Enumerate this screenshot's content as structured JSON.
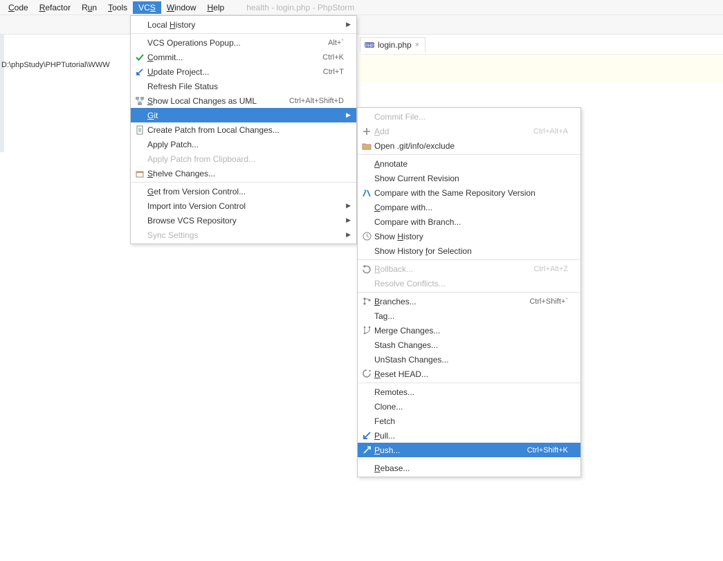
{
  "window_title": "health - login.php - PhpStorm",
  "menubar": [
    "Code",
    "Refactor",
    "Run",
    "Tools",
    "VCS",
    "Window",
    "Help"
  ],
  "menubar_active_index": 4,
  "breadcrumb": "D:\\phpStudy\\PHPTutorial\\WWW",
  "tab": {
    "label": "login.php"
  },
  "vcs_menu": [
    {
      "type": "item",
      "label": "Local History",
      "submenu": true
    },
    {
      "type": "sep"
    },
    {
      "type": "item",
      "label": "VCS Operations Popup...",
      "shortcut": "Alt+`"
    },
    {
      "type": "item",
      "icon": "check",
      "label": "Commit...",
      "shortcut": "Ctrl+K"
    },
    {
      "type": "item",
      "icon": "update",
      "label": "Update Project...",
      "shortcut": "Ctrl+T"
    },
    {
      "type": "item",
      "label": "Refresh File Status"
    },
    {
      "type": "item",
      "icon": "uml",
      "label": "Show Local Changes as UML",
      "shortcut": "Ctrl+Alt+Shift+D"
    },
    {
      "type": "item",
      "label": "Git",
      "submenu": true,
      "highlight": true
    },
    {
      "type": "item",
      "icon": "patch",
      "label": "Create Patch from Local Changes..."
    },
    {
      "type": "item",
      "label": "Apply Patch..."
    },
    {
      "type": "item",
      "label": "Apply Patch from Clipboard...",
      "disabled": true
    },
    {
      "type": "item",
      "icon": "shelve",
      "label": "Shelve Changes..."
    },
    {
      "type": "sep"
    },
    {
      "type": "item",
      "label": "Get from Version Control..."
    },
    {
      "type": "item",
      "label": "Import into Version Control",
      "submenu": true
    },
    {
      "type": "item",
      "label": "Browse VCS Repository",
      "submenu": true
    },
    {
      "type": "item",
      "label": "Sync Settings",
      "submenu": true,
      "disabled": true
    }
  ],
  "git_menu": [
    {
      "type": "item",
      "label": "Commit File...",
      "disabled": true
    },
    {
      "type": "item",
      "icon": "plus",
      "label": "Add",
      "shortcut": "Ctrl+Alt+A",
      "disabled": true
    },
    {
      "type": "item",
      "icon": "folder",
      "label": "Open .git/info/exclude"
    },
    {
      "type": "sep"
    },
    {
      "type": "item",
      "label": "Annotate"
    },
    {
      "type": "item",
      "label": "Show Current Revision"
    },
    {
      "type": "item",
      "icon": "compare",
      "label": "Compare with the Same Repository Version"
    },
    {
      "type": "item",
      "label": "Compare with..."
    },
    {
      "type": "item",
      "label": "Compare with Branch..."
    },
    {
      "type": "item",
      "icon": "clock",
      "label": "Show History"
    },
    {
      "type": "item",
      "label": "Show History for Selection"
    },
    {
      "type": "sep"
    },
    {
      "type": "item",
      "icon": "rollback",
      "label": "Rollback...",
      "shortcut": "Ctrl+Alt+Z",
      "disabled": true
    },
    {
      "type": "item",
      "label": "Resolve Conflicts...",
      "disabled": true
    },
    {
      "type": "sep"
    },
    {
      "type": "item",
      "icon": "branch",
      "label": "Branches...",
      "shortcut": "Ctrl+Shift+`"
    },
    {
      "type": "item",
      "label": "Tag..."
    },
    {
      "type": "item",
      "icon": "merge",
      "label": "Merge Changes..."
    },
    {
      "type": "item",
      "label": "Stash Changes..."
    },
    {
      "type": "item",
      "label": "UnStash Changes..."
    },
    {
      "type": "item",
      "icon": "reset",
      "label": "Reset HEAD..."
    },
    {
      "type": "sep"
    },
    {
      "type": "item",
      "label": "Remotes..."
    },
    {
      "type": "item",
      "label": "Clone..."
    },
    {
      "type": "item",
      "label": "Fetch"
    },
    {
      "type": "item",
      "icon": "pull",
      "label": "Pull..."
    },
    {
      "type": "item",
      "icon": "push",
      "label": "Push...",
      "shortcut": "Ctrl+Shift+K",
      "highlight": true
    },
    {
      "type": "sep"
    },
    {
      "type": "item",
      "label": "Rebase..."
    }
  ]
}
